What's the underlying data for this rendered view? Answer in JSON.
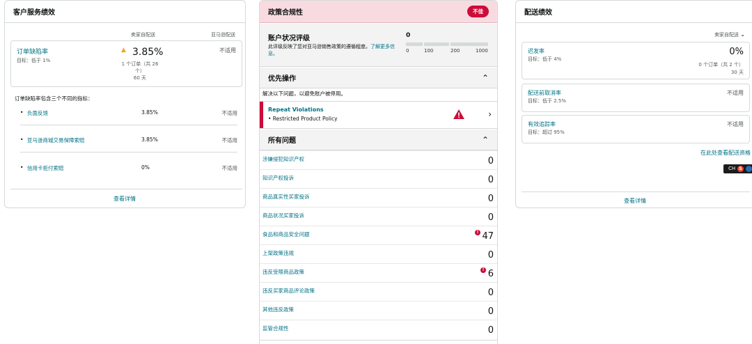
{
  "customer_service": {
    "title": "客户服务绩效",
    "col_seller": "卖家自配送",
    "col_amazon": "亚马逊配送",
    "odr": {
      "name": "订单缺陷率",
      "target": "目标：低于 1%",
      "value": "3.85%",
      "detail_line1": "1 个订单（共 26",
      "detail_line2": "个）",
      "detail_line3": "60 天",
      "amazon_value": "不适用"
    },
    "intro": "订单缺陷率包含三个不同的指标：",
    "metrics": [
      {
        "name": "负面反馈",
        "value": "3.85%",
        "amazon": "不适用"
      },
      {
        "name": "亚马逊商城交易保障索赔",
        "value": "3.85%",
        "amazon": "不适用"
      },
      {
        "name": "信用卡拒付索赔",
        "value": "0%",
        "amazon": "不适用"
      }
    ],
    "view_details": "查看详情"
  },
  "policy": {
    "title": "政策合规性",
    "badge": "不佳",
    "ahr": {
      "title": "账户状况评级",
      "desc": "此评级反映了您对亚马逊销售政策的遵循程度。",
      "link": "了解更多信息。",
      "score": "0",
      "ticks": [
        "0",
        "100",
        "200",
        "1000"
      ]
    },
    "priority": {
      "title": "优先操作",
      "desc": "解决以下问题，以避免账户被停用。",
      "violation_title": "Repeat Violations",
      "violation_sub": "• Restricted Product Policy"
    },
    "all_issues": {
      "title": "所有问题",
      "items": [
        {
          "name": "涉嫌侵犯知识产权",
          "count": "0",
          "alert": false
        },
        {
          "name": "知识产权投诉",
          "count": "0",
          "alert": false
        },
        {
          "name": "商品真实性买家投诉",
          "count": "0",
          "alert": false
        },
        {
          "name": "商品状况买家投诉",
          "count": "0",
          "alert": false
        },
        {
          "name": "食品和商品安全问题",
          "count": "47",
          "alert": true
        },
        {
          "name": "上架政策违规",
          "count": "0",
          "alert": false
        },
        {
          "name": "违反受限商品政策",
          "count": "6",
          "alert": true
        },
        {
          "name": "违反买家商品评论政策",
          "count": "0",
          "alert": false
        },
        {
          "name": "其他违反政策",
          "count": "0",
          "alert": false
        },
        {
          "name": "监管合规性",
          "count": "0",
          "alert": false
        }
      ]
    }
  },
  "shipping": {
    "title": "配送绩效",
    "selector": "卖家自配送",
    "late": {
      "name": "迟发率",
      "target": "目标：低于 4%",
      "value": "0%",
      "sub1": "0 个订单（共 2 个）",
      "sub2": "30 天"
    },
    "cancel": {
      "name": "配送前取消率",
      "target": "目标：低于 2.5%",
      "value": "不适用"
    },
    "tracking": {
      "name": "有效追踪率",
      "target": "目标：超过 95%",
      "value": "不适用"
    },
    "eligibility_link": "在此处查看配送资格",
    "ext_label": "CH",
    "view_details": "查看详情"
  },
  "colors": {
    "accent_link": "#007185",
    "danger": "#cc0c39",
    "warning": "#f0a81c",
    "header_pink": "#f8dbe0"
  },
  "icons": [
    "warning-icon",
    "chevron-up-icon",
    "chevron-right-icon",
    "chevron-down-icon",
    "alert-dot-icon"
  ]
}
